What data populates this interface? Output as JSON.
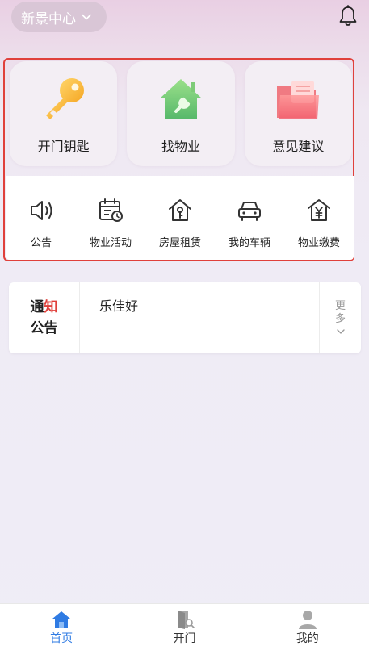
{
  "header": {
    "location": "新景中心",
    "location_icon": "chevron-down-icon",
    "bell_icon": "bell-icon"
  },
  "main_features": [
    {
      "label": "开门钥匙",
      "icon": "key-icon"
    },
    {
      "label": "找物业",
      "icon": "house-wrench-icon"
    },
    {
      "label": "意见建议",
      "icon": "folder-icon"
    }
  ],
  "quick_actions": [
    {
      "label": "公告",
      "icon": "speaker-icon"
    },
    {
      "label": "物业活动",
      "icon": "calendar-clock-icon"
    },
    {
      "label": "房屋租赁",
      "icon": "house-key-icon"
    },
    {
      "label": "我的车辆",
      "icon": "car-icon"
    },
    {
      "label": "物业缴费",
      "icon": "house-yen-icon"
    }
  ],
  "notice": {
    "tag_line1_a": "通",
    "tag_line1_b": "知",
    "tag_line2": "公告",
    "text": "乐佳好",
    "more_line1": "更",
    "more_line2": "多"
  },
  "tabbar": [
    {
      "label": "首页",
      "icon": "home-icon",
      "active": true
    },
    {
      "label": "开门",
      "icon": "door-icon",
      "active": false
    },
    {
      "label": "我的",
      "icon": "user-icon",
      "active": false
    }
  ],
  "colors": {
    "accent": "#2f7be3",
    "highlight_border": "#e0403b",
    "notice_red": "#e0403b"
  }
}
